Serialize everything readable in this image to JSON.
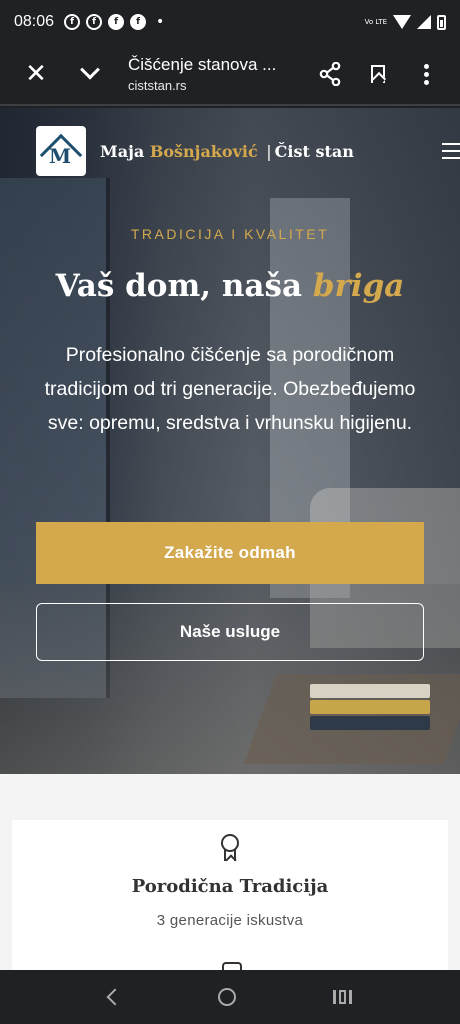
{
  "status_bar": {
    "time": "08:06",
    "notification_icons": [
      "facebook-outline-icon",
      "facebook-outline-icon",
      "facebook-filled-icon",
      "facebook-filled-icon"
    ],
    "dot": "•",
    "volte": "Vo LTE"
  },
  "browser": {
    "page_title": "Čišćenje stanova ...",
    "url": "ciststan.rs"
  },
  "site": {
    "brand_first": "Maja",
    "brand_accent": "Bošnjaković",
    "brand_sep": "|",
    "brand_second": "Čist stan",
    "logo_letter": "M"
  },
  "hero": {
    "eyebrow": "TRADICIJA I KVALITET",
    "headline_main": "Vaš dom, naša",
    "headline_accent": "briga",
    "lead": "Profesionalno čišćenje sa porodičnom tradicijom od tri generacije. Obezbeđujemo sve: opremu, sredstva i vrhunsku higijenu.",
    "cta_primary": "Zakažite odmah",
    "cta_secondary": "Naše usluge"
  },
  "features": {
    "items": [
      {
        "icon": "award-icon",
        "title": "Porodična Tradicija",
        "subtitle": "3 generacije iskustva"
      },
      {
        "icon": "shield-icon"
      }
    ]
  },
  "colors": {
    "accent_gold": "#d4a94e",
    "dark_ui": "#202124",
    "logo_blue": "#1f4f6e"
  }
}
